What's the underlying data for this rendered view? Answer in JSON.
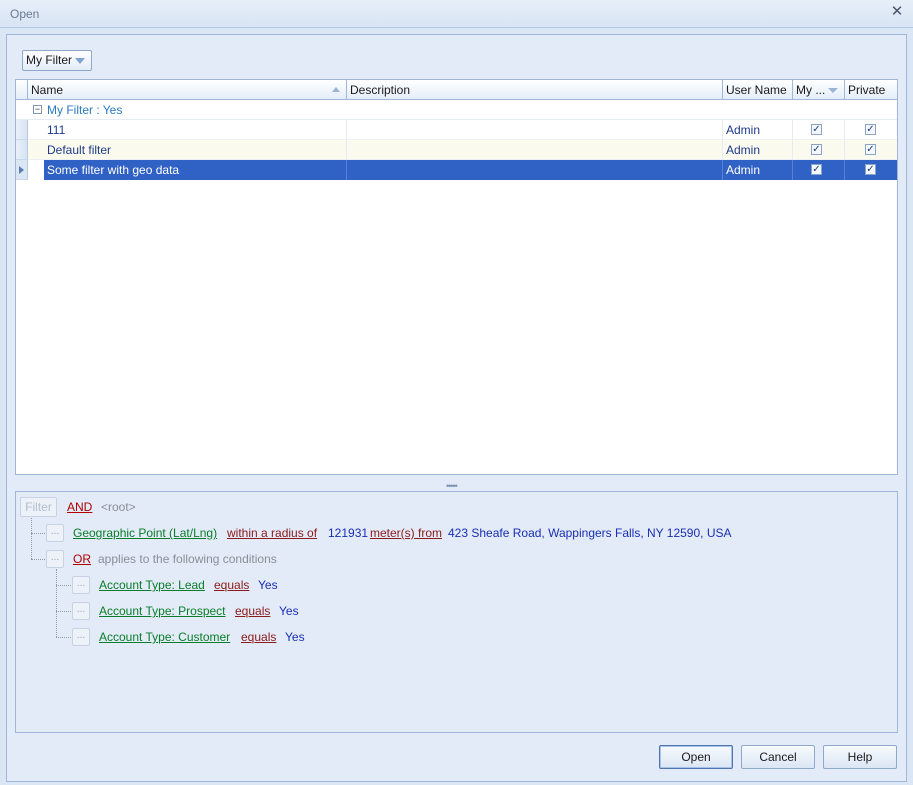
{
  "window": {
    "title": "Open"
  },
  "filter_dropdown": {
    "label": "My Filter"
  },
  "grid": {
    "columns": [
      "Name",
      "Description",
      "User Name",
      "My ...",
      "Private"
    ],
    "group": {
      "label": "My Filter : Yes",
      "toggle": "⊟"
    },
    "rows": [
      {
        "name": "111",
        "description": "",
        "user": "Admin",
        "my": true,
        "private": true
      },
      {
        "name": "Default filter",
        "description": "",
        "user": "Admin",
        "my": true,
        "private": true
      },
      {
        "name": "Some filter with geo data",
        "description": "",
        "user": "Admin",
        "my": true,
        "private": true
      }
    ],
    "selected_row": 2
  },
  "filter_editor": {
    "filter_button": "Filter",
    "root_op": "AND",
    "root_label": "<root>",
    "dots": "...",
    "geo": {
      "field": "Geographic Point (Lat/Lng)",
      "op": "within a radius of",
      "value": "121931",
      "unit": "meter(s) from",
      "address": "423 Sheafe Road, Wappingers Falls, NY 12590, USA"
    },
    "group": {
      "op": "OR",
      "label": "applies to the following conditions"
    },
    "conditions": [
      {
        "field": "Account Type: Lead",
        "op": "equals",
        "value": "Yes"
      },
      {
        "field": "Account Type: Prospect",
        "op": "equals",
        "value": "Yes"
      },
      {
        "field": "Account Type: Customer",
        "op": "equals",
        "value": "Yes"
      }
    ]
  },
  "buttons": {
    "open": "Open",
    "cancel": "Cancel",
    "help": "Help"
  },
  "colors": {
    "selection": "#3061c4",
    "accent": "#1e3a8a",
    "field": "#0a7d2a",
    "operator": "#b00000",
    "value": "#1a2eb5"
  }
}
